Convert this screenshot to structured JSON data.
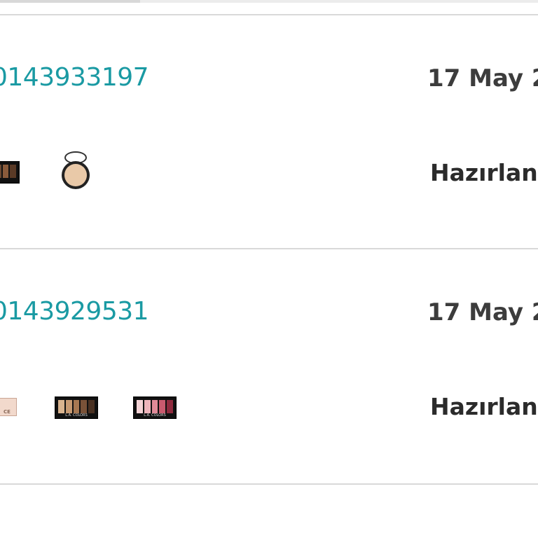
{
  "orders": [
    {
      "order_number": "0143933197",
      "date": "17 May 2",
      "status": "Hazırlan",
      "products": [
        "eyeshadow-palette",
        "compact-powder"
      ]
    },
    {
      "order_number": "0143929531",
      "date": "17 May 2",
      "status": "Hazırlan",
      "products": [
        "nude-palette",
        "eyeshadow-palette-nude",
        "eyeshadow-palette-pink"
      ],
      "thumb_labels": [
        "L.A. COLORS",
        "L.A. COLORS"
      ]
    }
  ],
  "colors": {
    "order_number": "#1a9aa3",
    "text_dark": "#2b2b2b",
    "divider": "#d9d9d9"
  }
}
